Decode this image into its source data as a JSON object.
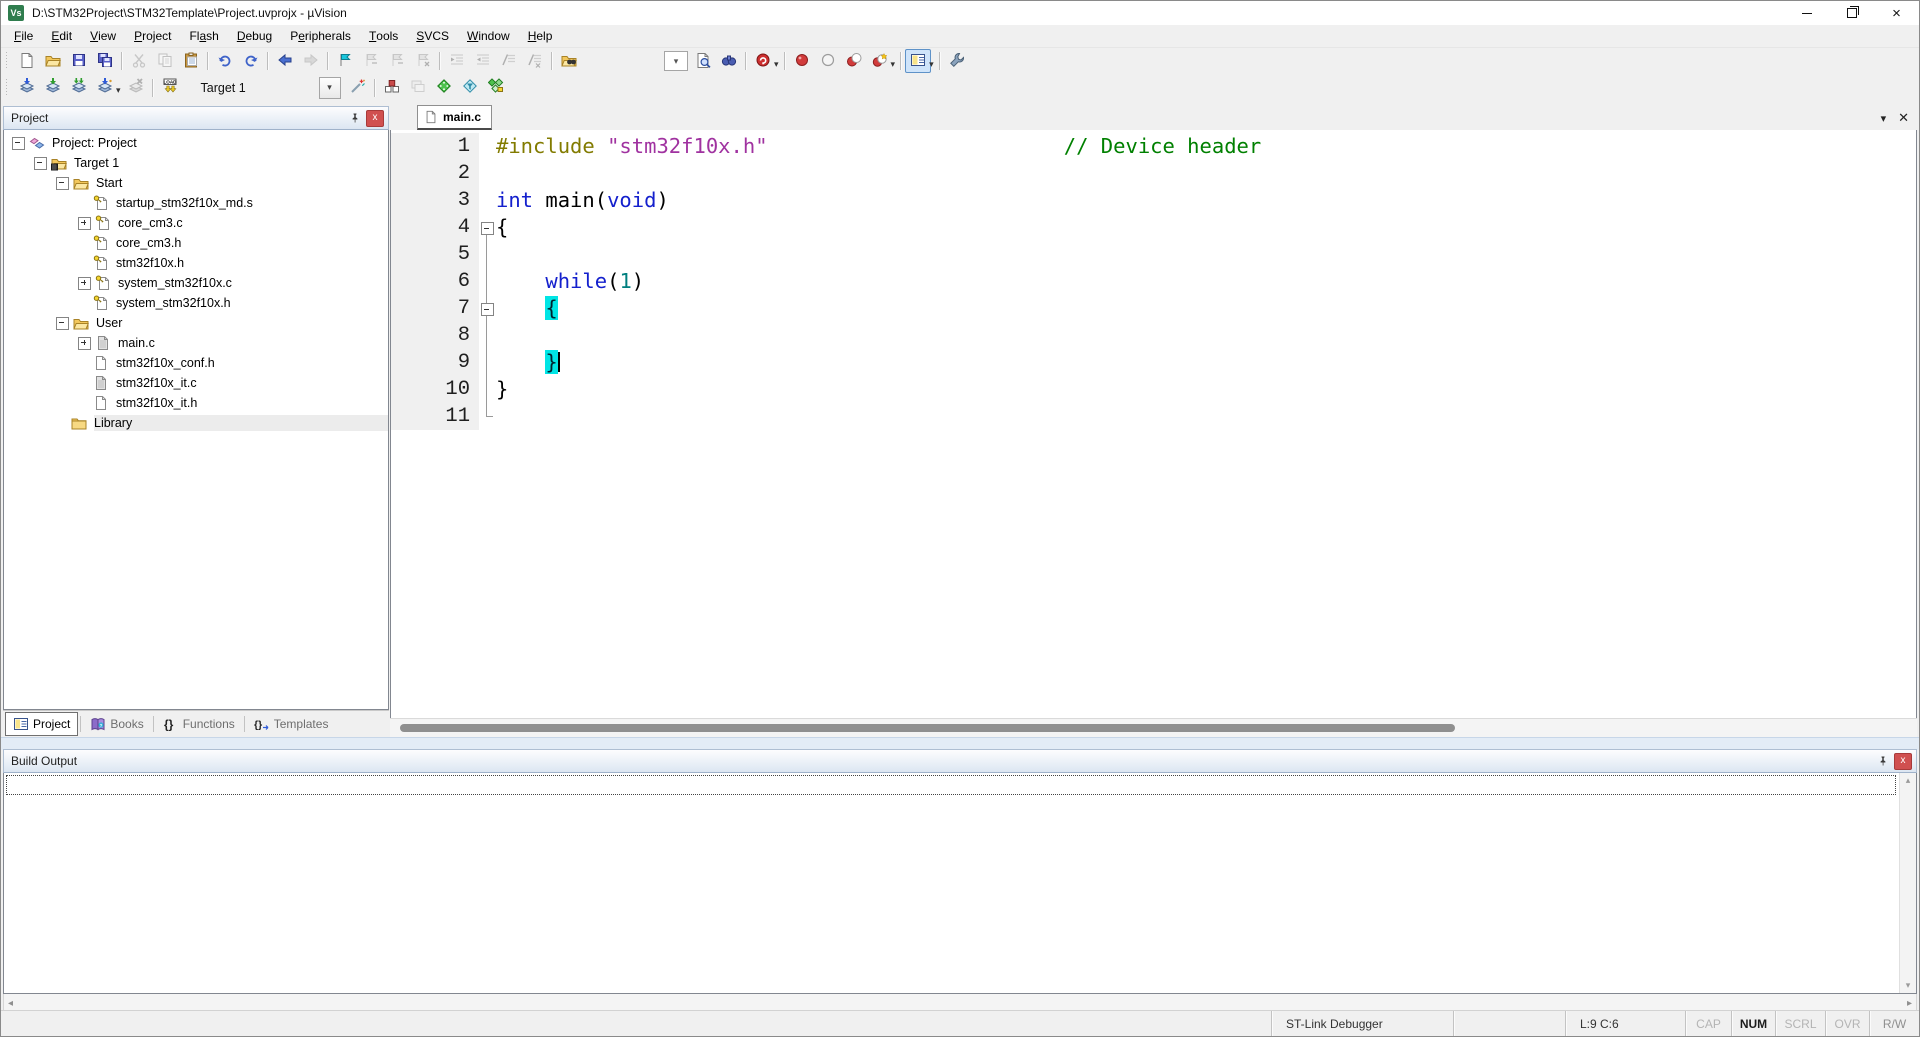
{
  "window": {
    "title": "D:\\STM32Project\\STM32Template\\Project.uvprojx - µVision",
    "app_icon_text": "Vs",
    "controls": [
      "minimize",
      "maximize-restore",
      "close"
    ]
  },
  "menu": {
    "items": [
      {
        "label": "File",
        "u": 0
      },
      {
        "label": "Edit",
        "u": 0
      },
      {
        "label": "View",
        "u": 0
      },
      {
        "label": "Project",
        "u": 0
      },
      {
        "label": "Flash",
        "u": 2
      },
      {
        "label": "Debug",
        "u": 0
      },
      {
        "label": "Peripherals",
        "u": 1
      },
      {
        "label": "Tools",
        "u": 0
      },
      {
        "label": "SVCS",
        "u": 0
      },
      {
        "label": "Window",
        "u": 0
      },
      {
        "label": "Help",
        "u": 0
      }
    ]
  },
  "toolbar1": [
    {
      "type": "grip"
    },
    {
      "name": "new-file-button",
      "icon": "doc-new",
      "on": true
    },
    {
      "name": "open-file-button",
      "icon": "folder-open",
      "on": true
    },
    {
      "name": "save-button",
      "icon": "floppy",
      "on": true
    },
    {
      "name": "save-all-button",
      "icon": "floppy-multi",
      "on": true
    },
    {
      "type": "sep"
    },
    {
      "name": "cut-button",
      "icon": "scissors",
      "on": false
    },
    {
      "name": "copy-button",
      "icon": "copy-docs",
      "on": false
    },
    {
      "name": "paste-button",
      "icon": "clipboard",
      "on": true
    },
    {
      "type": "sep"
    },
    {
      "name": "undo-button",
      "icon": "undo",
      "on": true
    },
    {
      "name": "redo-button",
      "icon": "redo",
      "on": true
    },
    {
      "type": "sep"
    },
    {
      "name": "navigate-back-button",
      "icon": "arrow-left",
      "on": true
    },
    {
      "name": "navigate-forward-button",
      "icon": "arrow-right",
      "on": false
    },
    {
      "type": "sep"
    },
    {
      "name": "toggle-bookmark-button",
      "icon": "flag-cyan",
      "on": true
    },
    {
      "name": "next-bookmark-button",
      "icon": "flag-gray",
      "on": false
    },
    {
      "name": "prev-bookmark-button",
      "icon": "flag-gray",
      "on": false
    },
    {
      "name": "clear-bookmarks-button",
      "icon": "flag-clear",
      "on": false
    },
    {
      "type": "sep"
    },
    {
      "name": "indent-button",
      "icon": "indent",
      "on": false
    },
    {
      "name": "unindent-button",
      "icon": "outdent",
      "on": false
    },
    {
      "name": "comment-button",
      "icon": "comment",
      "on": false
    },
    {
      "name": "uncomment-button",
      "icon": "uncomment",
      "on": false
    },
    {
      "type": "sep"
    },
    {
      "name": "find-in-files-button",
      "icon": "folder-binocs",
      "on": true
    },
    {
      "type": "gap",
      "w": 80
    },
    {
      "name": "find-combo",
      "combo": true
    },
    {
      "name": "find-button",
      "icon": "doc-magnifier",
      "on": true
    },
    {
      "name": "incremental-find-button",
      "icon": "binoculars",
      "on": true
    },
    {
      "type": "sep"
    },
    {
      "name": "find-in-files-dropdown-button",
      "icon": "red-orb",
      "on": true,
      "dd": true
    },
    {
      "type": "sep"
    },
    {
      "name": "insert-breakpoint-button",
      "icon": "bp-dot",
      "on": true
    },
    {
      "name": "disable-breakpoint-button",
      "icon": "bp-hollow",
      "on": true
    },
    {
      "name": "disable-all-breakpoints-button",
      "icon": "bp-two",
      "on": true
    },
    {
      "name": "kill-all-breakpoints-button",
      "icon": "bp-star",
      "on": true,
      "dd": true
    },
    {
      "type": "sep"
    },
    {
      "name": "debug-windows-button",
      "icon": "win-panel",
      "on": true,
      "dd": true,
      "active": true
    },
    {
      "type": "sep"
    },
    {
      "name": "configure-button",
      "icon": "wrench",
      "on": true
    }
  ],
  "toolbar2": [
    {
      "type": "grip"
    },
    {
      "name": "translate-button",
      "icon": "stack-translate",
      "on": true
    },
    {
      "name": "build-button",
      "icon": "stack-build",
      "on": true
    },
    {
      "name": "rebuild-button",
      "icon": "stack-rebuild",
      "on": true
    },
    {
      "name": "batch-build-button",
      "icon": "stack-batch",
      "on": true,
      "dd": true
    },
    {
      "name": "stop-build-button",
      "icon": "stack-stop",
      "on": false
    },
    {
      "type": "sep"
    },
    {
      "name": "download-button",
      "icon": "load",
      "on": true
    },
    {
      "type": "gap",
      "w": 6
    },
    {
      "name": "target-combo",
      "combo2": true
    },
    {
      "name": "options-for-target-button",
      "icon": "wand",
      "on": true
    },
    {
      "type": "sep"
    },
    {
      "name": "manage-project-items-button",
      "icon": "cube-blocks",
      "on": true
    },
    {
      "name": "manage-layout-button",
      "icon": "win-gray",
      "on": false
    },
    {
      "name": "manage-rte-button",
      "icon": "diamond-green",
      "on": true
    },
    {
      "name": "select-software-packs-button",
      "icon": "diamond-funnel",
      "on": true
    },
    {
      "name": "pack-installer-button",
      "icon": "diamond-pack",
      "on": true
    }
  ],
  "target_select": {
    "value": "Target 1"
  },
  "project_panel": {
    "title": "Project",
    "tree": [
      {
        "label": "Project: Project",
        "lvl": 0,
        "exp": "minus",
        "icon": "tree-project"
      },
      {
        "label": "Target 1",
        "lvl": 1,
        "exp": "minus",
        "icon": "tree-target"
      },
      {
        "label": "Start",
        "lvl": 2,
        "exp": "minus",
        "icon": "tree-folder-open"
      },
      {
        "label": "startup_stm32f10x_md.s",
        "lvl": 3,
        "exp": null,
        "icon": "tree-file-key"
      },
      {
        "label": "core_cm3.c",
        "lvl": 3,
        "exp": "plus",
        "icon": "tree-file-key"
      },
      {
        "label": "core_cm3.h",
        "lvl": 3,
        "exp": null,
        "icon": "tree-file-key"
      },
      {
        "label": "stm32f10x.h",
        "lvl": 3,
        "exp": null,
        "icon": "tree-file-key"
      },
      {
        "label": "system_stm32f10x.c",
        "lvl": 3,
        "exp": "plus",
        "icon": "tree-file-key"
      },
      {
        "label": "system_stm32f10x.h",
        "lvl": 3,
        "exp": null,
        "icon": "tree-file-key"
      },
      {
        "label": "User",
        "lvl": 2,
        "exp": "minus",
        "icon": "tree-folder-open"
      },
      {
        "label": "main.c",
        "lvl": 3,
        "exp": "plus",
        "icon": "tree-file-shaded"
      },
      {
        "label": "stm32f10x_conf.h",
        "lvl": 3,
        "exp": null,
        "icon": "tree-file"
      },
      {
        "label": "stm32f10x_it.c",
        "lvl": 3,
        "exp": null,
        "icon": "tree-file-shaded"
      },
      {
        "label": "stm32f10x_it.h",
        "lvl": 3,
        "exp": null,
        "icon": "tree-file"
      },
      {
        "label": "Library",
        "lvl": 2,
        "exp": null,
        "icon": "tree-folder",
        "sel": true
      }
    ],
    "tabs": [
      {
        "label": "Project",
        "icon": "tab-project",
        "active": true
      },
      {
        "label": "Books",
        "icon": "tab-books"
      },
      {
        "label": "Functions",
        "icon": "tab-functions"
      },
      {
        "label": "Templates",
        "icon": "tab-templates"
      }
    ]
  },
  "editor": {
    "tab_label": "main.c",
    "tab_controls": [
      "tab-list-dropdown",
      "close-file"
    ],
    "lines": [
      {
        "n": "1",
        "fold": null,
        "segs": [
          {
            "c": "pp",
            "t": "#include "
          },
          {
            "c": "str",
            "t": "\"stm32f10x.h\""
          },
          {
            "c": "pl",
            "t": "                        "
          },
          {
            "c": "com",
            "t": "// Device header"
          }
        ]
      },
      {
        "n": "2",
        "fold": null,
        "segs": []
      },
      {
        "n": "3",
        "fold": null,
        "segs": [
          {
            "c": "kw",
            "t": "int"
          },
          {
            "c": "pl",
            "t": " main("
          },
          {
            "c": "kw",
            "t": "void"
          },
          {
            "c": "pl",
            "t": ")"
          }
        ]
      },
      {
        "n": "4",
        "fold": "box",
        "segs": [
          {
            "c": "pl",
            "t": "{"
          }
        ]
      },
      {
        "n": "5",
        "fold": "line",
        "segs": []
      },
      {
        "n": "6",
        "fold": "line",
        "segs": [
          {
            "c": "pl",
            "t": "    "
          },
          {
            "c": "kw",
            "t": "while"
          },
          {
            "c": "pl",
            "t": "("
          },
          {
            "c": "num",
            "t": "1"
          },
          {
            "c": "pl",
            "t": ")"
          }
        ]
      },
      {
        "n": "7",
        "fold": "boxline",
        "segs": [
          {
            "c": "pl",
            "t": "    "
          },
          {
            "c": "hl",
            "t": "{"
          }
        ]
      },
      {
        "n": "8",
        "fold": "line",
        "segs": []
      },
      {
        "n": "9",
        "fold": "line",
        "segs": [
          {
            "c": "pl",
            "t": "    "
          },
          {
            "c": "hl",
            "t": "}"
          },
          {
            "c": "caret",
            "t": ""
          }
        ]
      },
      {
        "n": "10",
        "fold": "line",
        "segs": [
          {
            "c": "pl",
            "t": "}"
          }
        ]
      },
      {
        "n": "11",
        "fold": "end",
        "segs": []
      }
    ]
  },
  "build_output": {
    "title": "Build Output"
  },
  "status_bar": {
    "debugger_label": "ST-Link Debugger",
    "cursor_position": "L:9 C:6",
    "indicators": [
      {
        "label": "CAP",
        "state": "off"
      },
      {
        "label": "NUM",
        "state": "on"
      },
      {
        "label": "SCRL",
        "state": "off"
      },
      {
        "label": "OVR",
        "state": "off"
      },
      {
        "label": "R/W",
        "state": "mid"
      }
    ]
  }
}
